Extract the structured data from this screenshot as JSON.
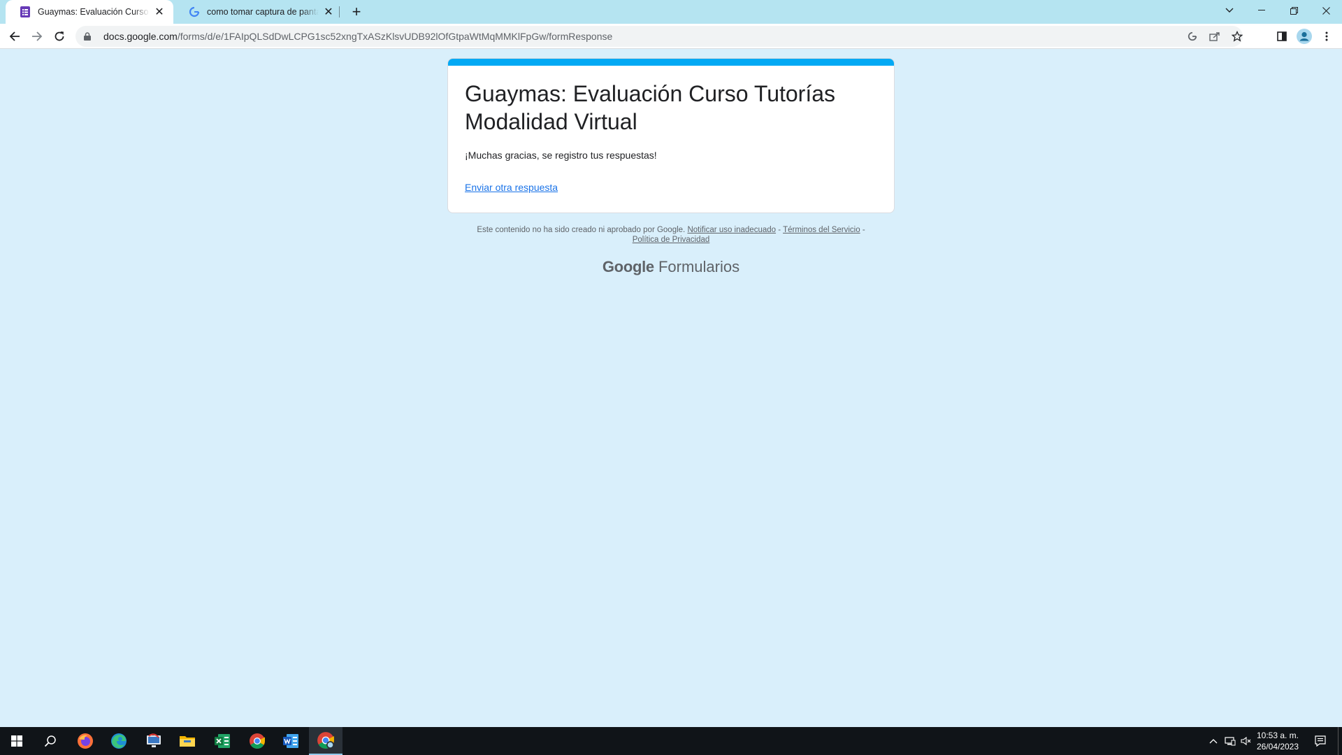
{
  "browser": {
    "tabs": [
      {
        "title": "Guaymas: Evaluación Curso Tutorías Modalidad Virtual",
        "icon": "google-forms-icon",
        "active": true
      },
      {
        "title": "como tomar captura de pantalla",
        "icon": "google-g-icon",
        "active": false
      }
    ],
    "url": {
      "host": "docs.google.com",
      "path": "/forms/d/e/1FAIpQLSdDwLCPG1sc52xngTxASzKlsvUDB92lOfGtpaWtMqMMKlFpGw/formResponse"
    }
  },
  "form": {
    "title_line1": "Guaymas: Evaluación Curso Tutorías",
    "title_line2": "Modalidad Virtual",
    "message": "¡Muchas gracias, se registro tus respuestas!",
    "link": "Enviar otra respuesta",
    "accent_color": "#03a9f4"
  },
  "footer": {
    "disclaimer": "Este contenido no ha sido creado ni aprobado por Google.",
    "report_link": "Notificar uso inadecuado",
    "terms_link": "Términos del Servicio",
    "privacy_link": "Política de Privacidad",
    "separator": " - ",
    "brand_google": "Google",
    "brand_product": "Formularios"
  },
  "taskbar": {
    "apps": [
      "windows-start",
      "search",
      "firefox",
      "edge",
      "remote-desktop",
      "file-explorer",
      "excel",
      "chrome",
      "word",
      "chrome-active"
    ],
    "time": "10:53 a. m.",
    "date": "26/04/2023"
  }
}
